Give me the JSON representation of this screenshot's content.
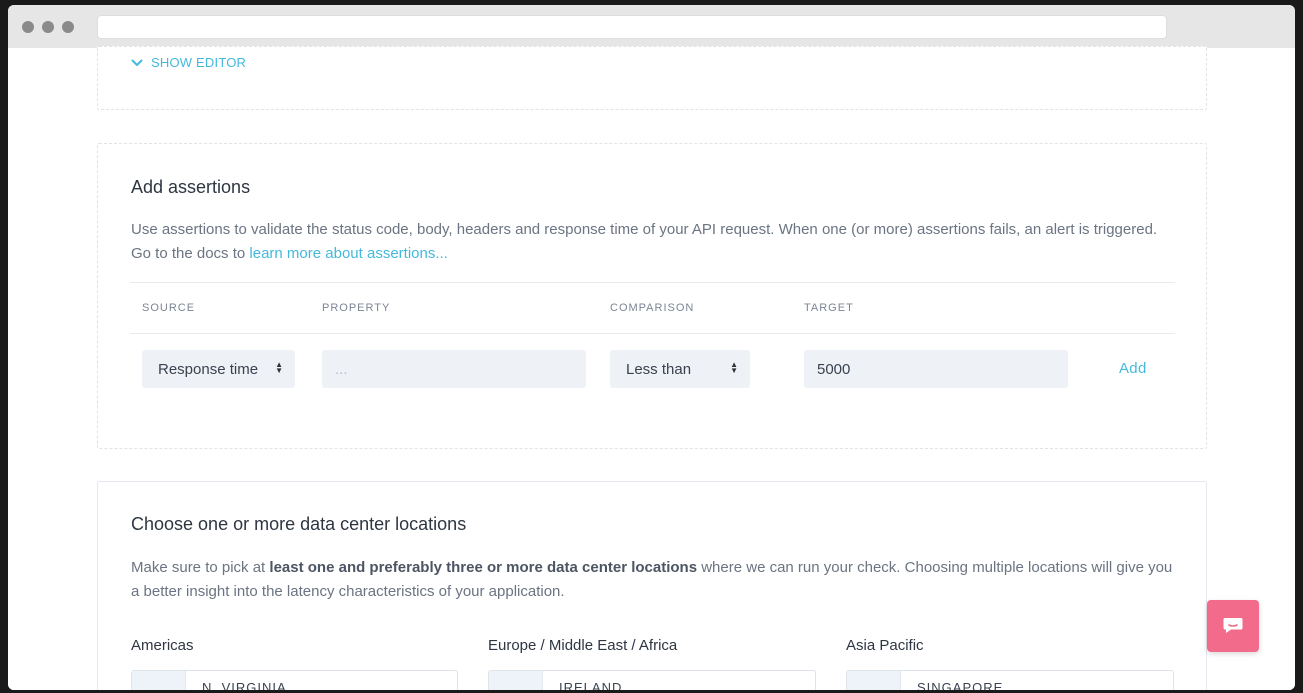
{
  "editor": {
    "show_editor_label": "SHOW EDITOR"
  },
  "assertions": {
    "title": "Add assertions",
    "description_part1": "Use assertions to validate the status code, body, headers and response time of your API request. When one (or more) assertions fails, an alert is triggered. Go to the docs to ",
    "docs_link": "learn more about assertions...",
    "columns": [
      "SOURCE",
      "PROPERTY",
      "COMPARISON",
      "TARGET"
    ],
    "source_value": "Response time",
    "property_placeholder": "...",
    "comparison_value": "Less than",
    "target_value": "5000",
    "add_label": "Add"
  },
  "locations": {
    "title": "Choose one or more data center locations",
    "description_pre": "Make sure to pick at ",
    "description_bold": "least one and preferably three or more data center locations",
    "description_post": " where we can run your check. Choosing multiple locations will give you a better insight into the latency characteristics of your application.",
    "regions": [
      {
        "name": "Americas",
        "first_location": "N. VIRGINIA"
      },
      {
        "name": "Europe / Middle East / Africa",
        "first_location": "IRELAND"
      },
      {
        "name": "Asia Pacific",
        "first_location": "SINGAPORE"
      }
    ]
  },
  "icons": {
    "chevron": "chevron-down-icon",
    "chat": "chat-icon",
    "select_arrows": "select-arrows-icon"
  },
  "colors": {
    "accent": "#45b9dc",
    "chat_button": "#f26b8a",
    "control_bg": "#eef1f5"
  }
}
